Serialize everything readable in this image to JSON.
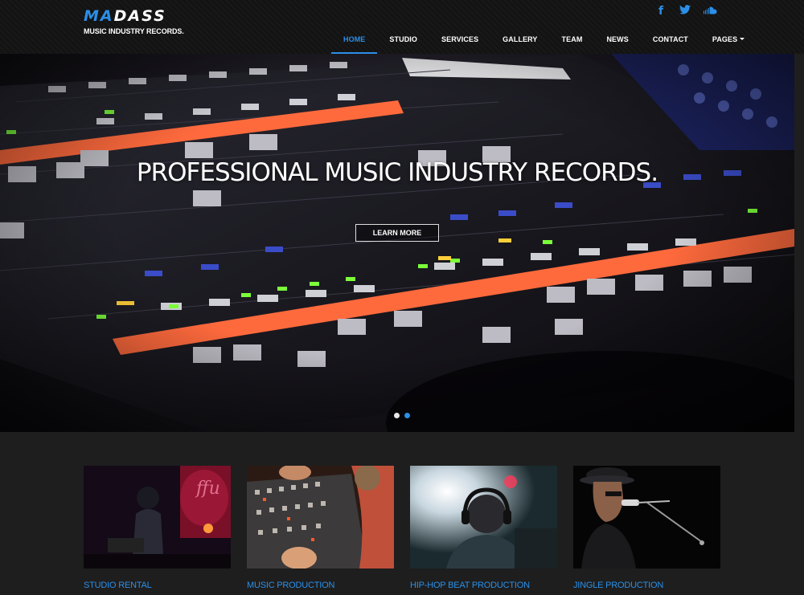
{
  "brand": {
    "logo_accent": "MA",
    "logo_rest": "DASS",
    "tagline": "MUSIC INDUSTRY RECORDS.",
    "accent_color": "#2b8fe8"
  },
  "social": [
    {
      "icon": "facebook-icon",
      "glyph": "f"
    },
    {
      "icon": "twitter-icon",
      "glyph": "t"
    },
    {
      "icon": "soundcloud-icon",
      "glyph": "☁"
    }
  ],
  "nav": {
    "items": [
      {
        "label": "HOME",
        "active": true
      },
      {
        "label": "STUDIO"
      },
      {
        "label": "SERVICES"
      },
      {
        "label": "GALLERY"
      },
      {
        "label": "TEAM"
      },
      {
        "label": "NEWS"
      },
      {
        "label": "CONTACT"
      },
      {
        "label": "PAGES"
      }
    ]
  },
  "hero": {
    "title": "PROFESSIONAL MUSIC INDUSTRY RECORDS.",
    "button_label": "LEARN MORE",
    "slide_count": 2,
    "active_slide": 2
  },
  "services": [
    {
      "title": "STUDIO RENTAL"
    },
    {
      "title": "MUSIC PRODUCTION"
    },
    {
      "title": "HIP-HOP BEAT PRODUCTION"
    },
    {
      "title": "JINGLE PRODUCTION"
    }
  ]
}
